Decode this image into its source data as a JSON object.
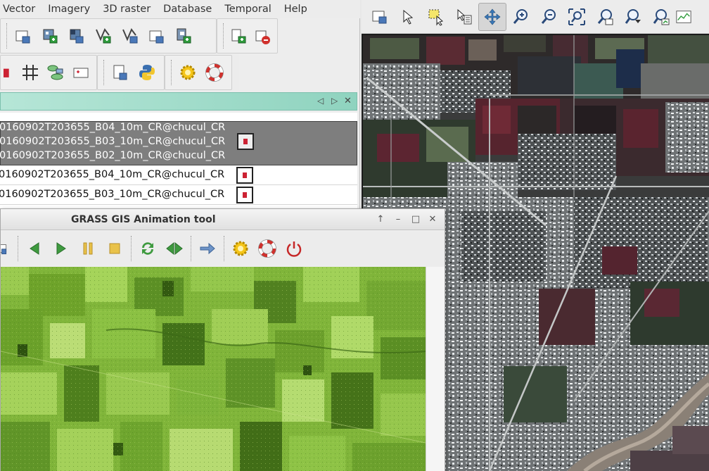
{
  "menubar": {
    "items": [
      "Vector",
      "Imagery",
      "3D raster",
      "Database",
      "Temporal",
      "Help"
    ]
  },
  "toolbar1": {
    "icons": [
      "add-raster-icon",
      "add-rgb-icon",
      "add-shaded-icon",
      "add-vector-icon",
      "add-vector-theme-icon",
      "add-overlay-icon",
      "add-group-icon",
      "import-icon",
      "remove-layer-icon"
    ]
  },
  "toolbar2": {
    "icons": [
      "raster-calc-icon",
      "grid-icon",
      "graphical-modeler-icon",
      "georectify-icon",
      "script-file-icon",
      "python-shell-icon",
      "settings-gear-icon",
      "help-lifebuoy-icon"
    ]
  },
  "layers": {
    "group_names": [
      "0160902T203655_B04_10m_CR@chucul_CR",
      "0160902T203655_B03_10m_CR@chucul_CR",
      "0160902T203655_B02_10m_CR@chucul_CR"
    ],
    "rows": [
      "0160902T203655_B04_10m_CR@chucul_CR",
      "0160902T203655_B03_10m_CR@chucul_CR"
    ]
  },
  "map_toolbar": {
    "icons": [
      "display-map-icon",
      "pointer-icon",
      "select-icon",
      "query-icon",
      "pan-icon",
      "zoom-in-icon",
      "zoom-out-icon",
      "zoom-extent-icon",
      "zoom-back-icon",
      "zoom-menu-icon",
      "analyze-icon",
      "overlay-icon"
    ]
  },
  "animation_tool": {
    "title": "GRASS GIS Animation tool",
    "window_controls": [
      "↑",
      "–",
      "□",
      "✕"
    ],
    "controls": [
      "add-animation-icon",
      "play-back-icon",
      "play-forward-icon",
      "pause-icon",
      "stop-icon",
      "loop-icon",
      "swing-icon",
      "speed-icon",
      "settings-icon",
      "help-icon",
      "quit-icon"
    ]
  },
  "colors": {
    "header_green": "#8fd3bf",
    "selected_group": "#7e7e7e",
    "vegetation": "#7fb53a"
  }
}
